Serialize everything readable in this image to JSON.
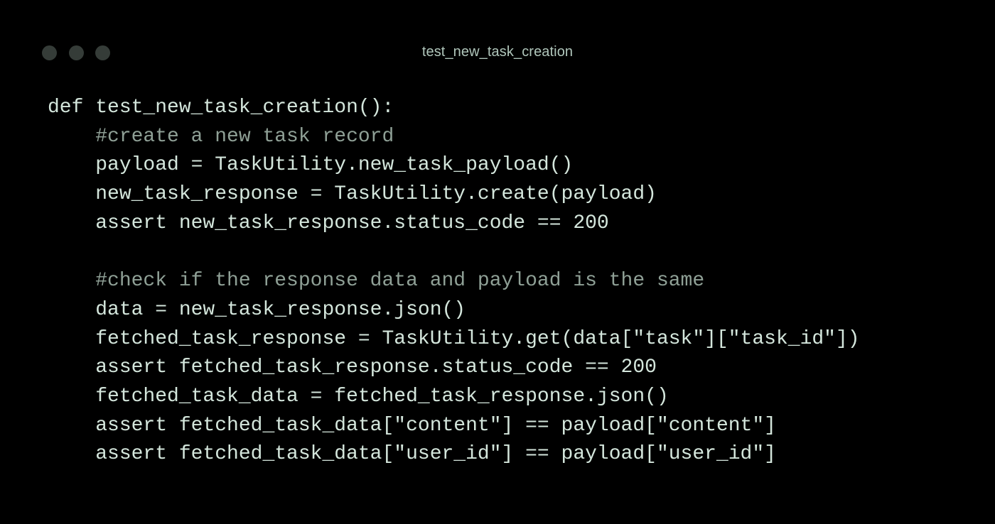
{
  "window": {
    "title": "test_new_task_creation",
    "controls": [
      "close",
      "minimize",
      "maximize"
    ]
  },
  "code": {
    "language": "python",
    "lines": [
      "def test_new_task_creation():",
      "    #create a new task record",
      "    payload = TaskUtility.new_task_payload()",
      "    new_task_response = TaskUtility.create(payload)",
      "    assert new_task_response.status_code == 200",
      "",
      "    #check if the response data and payload is the same",
      "    data = new_task_response.json()",
      "    fetched_task_response = TaskUtility.get(data[\"task\"][\"task_id\"])",
      "    assert fetched_task_response.status_code == 200",
      "    fetched_task_data = fetched_task_response.json()",
      "    assert fetched_task_data[\"content\"] == payload[\"content\"]",
      "    assert fetched_task_data[\"user_id\"] == payload[\"user_id\"]"
    ]
  },
  "colors": {
    "background": "#000000",
    "window_dot": "#353c38",
    "title_text": "#b0c6bb",
    "code_text": "#d4e6dc",
    "comment_text": "#8fa096"
  }
}
